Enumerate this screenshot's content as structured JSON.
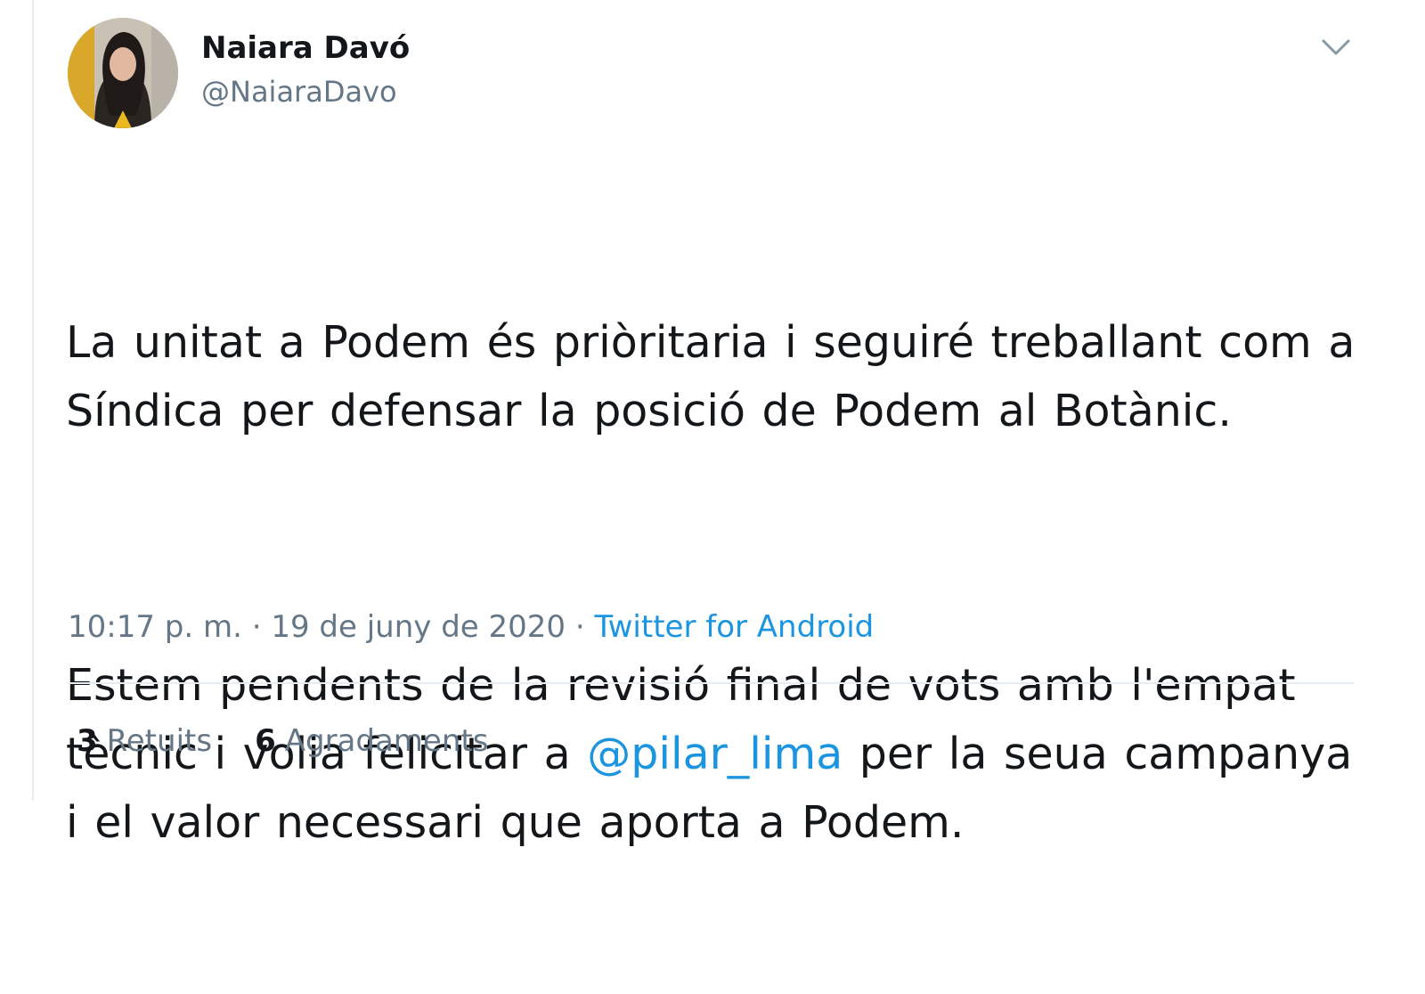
{
  "author": {
    "display_name": "Naiara Davó",
    "handle": "@NaiaraDavo"
  },
  "tweet": {
    "paragraph1": "La unitat a Podem és priòritaria i seguiré treballant com a Síndica per defensar la posició de Podem al Botànic.",
    "paragraph2_before": "Estem pendents de la revisió final de vots amb l'empat tècnic i volia felicitar a ",
    "mention": "@pilar_lima",
    "paragraph2_after": " per la seua campanya i el valor necessari que aporta a Podem."
  },
  "meta": {
    "time": "10:17 p. m.",
    "separator1": " · ",
    "date": "19 de juny de 2020",
    "separator2": " · ",
    "source": "Twitter for Android"
  },
  "stats": {
    "retweets_count": "3",
    "retweets_label": "Retuits",
    "likes_count": "6",
    "likes_label": "Agradaments"
  },
  "colors": {
    "link": "#1b95e0",
    "text": "#14171a",
    "secondary": "#657786",
    "border": "#e6ecf0"
  },
  "icons": {
    "menu": "chevron-down-icon"
  }
}
